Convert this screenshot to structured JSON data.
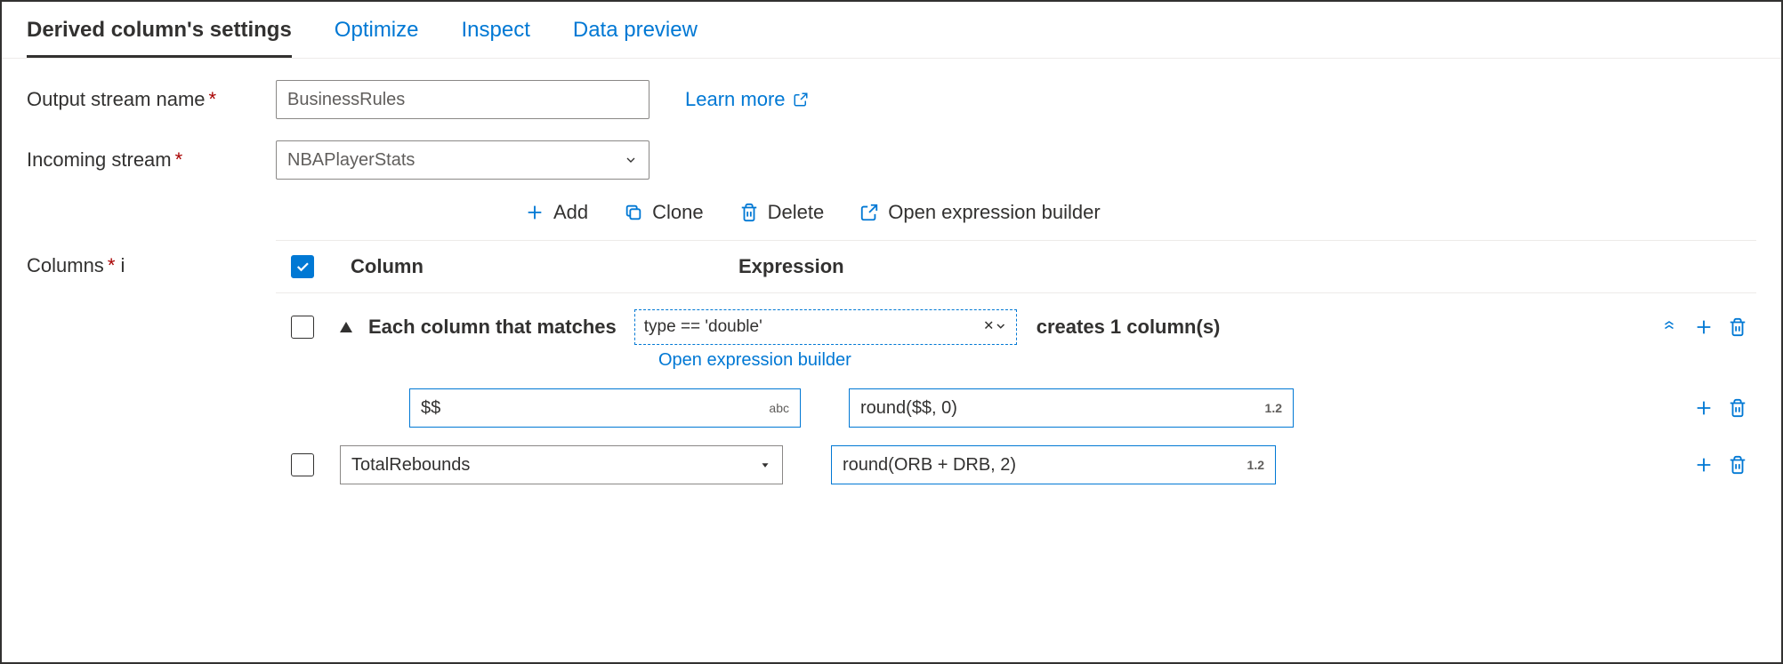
{
  "tabs": {
    "settings": "Derived column's settings",
    "optimize": "Optimize",
    "inspect": "Inspect",
    "preview": "Data preview"
  },
  "form": {
    "output_stream_label": "Output stream name",
    "output_stream_value": "BusinessRules",
    "learn_more": "Learn more",
    "incoming_stream_label": "Incoming stream",
    "incoming_stream_value": "NBAPlayerStats",
    "columns_label": "Columns"
  },
  "toolbar": {
    "add": "Add",
    "clone": "Clone",
    "delete": "Delete",
    "open_builder": "Open expression builder"
  },
  "table": {
    "header_column": "Column",
    "header_expression": "Expression",
    "pattern": {
      "prefix": "Each column that matches",
      "condition": "type == 'double'",
      "suffix": "creates 1 column(s)",
      "open_link": "Open expression builder",
      "col_name_expr": "$$",
      "col_name_badge": "abc",
      "value_expr": "round($$, 0)",
      "value_badge": "1.2"
    },
    "row": {
      "col_name": "TotalRebounds",
      "value_expr": "round(ORB + DRB, 2)",
      "value_badge": "1.2"
    }
  }
}
